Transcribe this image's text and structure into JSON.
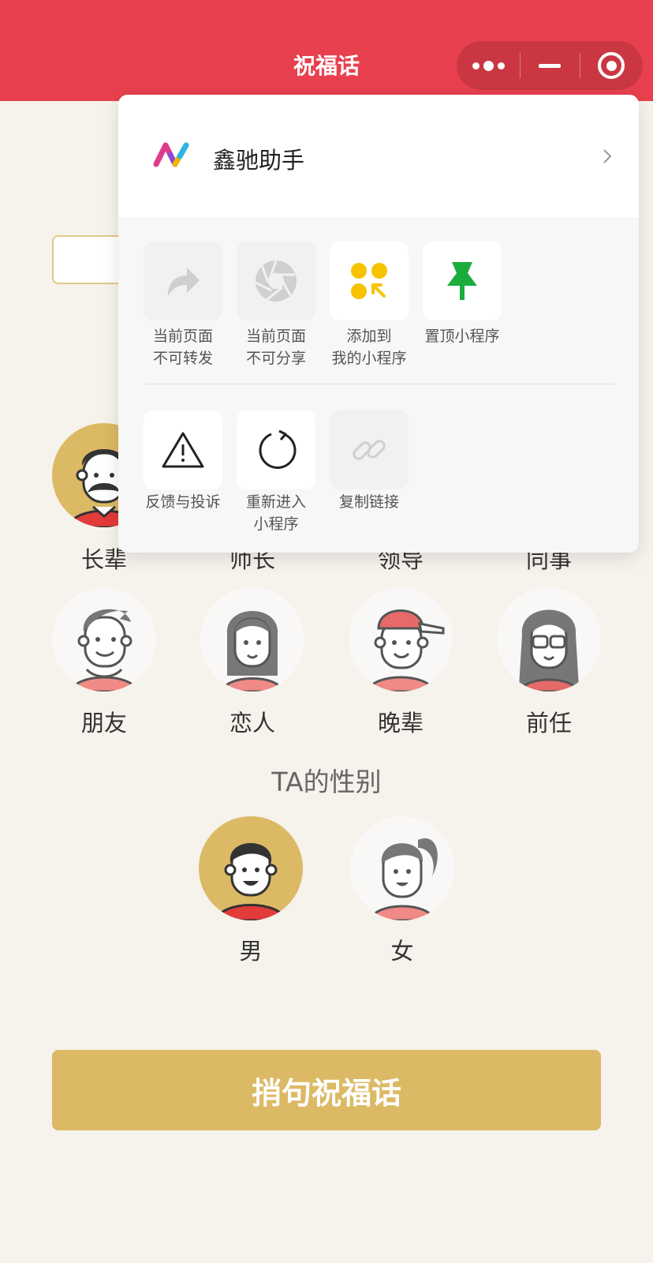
{
  "header": {
    "title": "祝福话"
  },
  "avatars": {
    "relations": [
      {
        "label": "长辈",
        "selected": true
      },
      {
        "label": "师长",
        "selected": false
      },
      {
        "label": "领导",
        "selected": false
      },
      {
        "label": "同事",
        "selected": false
      },
      {
        "label": "朋友",
        "selected": false
      },
      {
        "label": "恋人",
        "selected": false
      },
      {
        "label": "晚辈",
        "selected": false
      },
      {
        "label": "前任",
        "selected": false
      }
    ],
    "gender_title": "TA的性别",
    "genders": [
      {
        "label": "男",
        "selected": true
      },
      {
        "label": "女",
        "selected": false
      }
    ]
  },
  "action_button": {
    "label": "捎句祝福话"
  },
  "menu": {
    "app_name": "鑫驰助手",
    "items": [
      {
        "label_line1": "当前页面",
        "label_line2": "不可转发",
        "icon": "forward-icon",
        "disabled": true
      },
      {
        "label_line1": "当前页面",
        "label_line2": "不可分享",
        "icon": "aperture-icon",
        "disabled": true
      },
      {
        "label_line1": "添加到",
        "label_line2": "我的小程序",
        "icon": "add-mini-program-icon",
        "disabled": false
      },
      {
        "label_line1": "置顶小程序",
        "label_line2": "",
        "icon": "pin-icon",
        "disabled": false
      },
      {
        "label_line1": "反馈与投诉",
        "label_line2": "",
        "icon": "warning-icon",
        "disabled": false
      },
      {
        "label_line1": "重新进入",
        "label_line2": "小程序",
        "icon": "refresh-icon",
        "disabled": false
      },
      {
        "label_line1": "复制链接",
        "label_line2": "",
        "icon": "link-icon",
        "disabled": true
      }
    ]
  },
  "colors": {
    "header": "#e8404e",
    "accent": "#dcb964",
    "background": "#f6f2ec"
  }
}
